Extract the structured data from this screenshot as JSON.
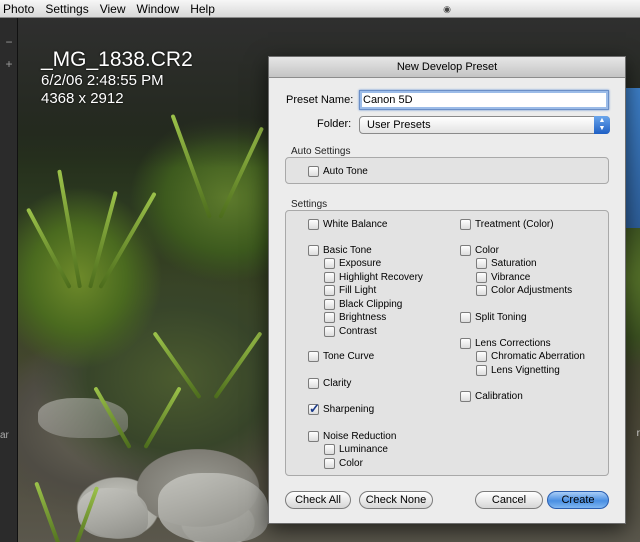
{
  "menubar": {
    "items": [
      "Photo",
      "Settings",
      "View",
      "Window",
      "Help"
    ]
  },
  "photo": {
    "filename": "_MG_1838.CR2",
    "datetime": "6/2/06 2:48:55 PM",
    "dimensions": "4368 x 2912",
    "left_edge_text": "ar"
  },
  "dialog": {
    "title": "New Develop Preset",
    "preset_name_label": "Preset Name:",
    "preset_name_value": "Canon 5D",
    "folder_label": "Folder:",
    "folder_value": "User Presets",
    "auto_settings_label": "Auto Settings",
    "auto_tone_label": "Auto Tone",
    "settings_label": "Settings",
    "left_column": {
      "white_balance": "White Balance",
      "basic_tone": "Basic Tone",
      "exposure": "Exposure",
      "highlight_recovery": "Highlight Recovery",
      "fill_light": "Fill Light",
      "black_clipping": "Black Clipping",
      "brightness": "Brightness",
      "contrast": "Contrast",
      "tone_curve": "Tone Curve",
      "clarity": "Clarity",
      "sharpening": "Sharpening",
      "noise_reduction": "Noise Reduction",
      "luminance": "Luminance",
      "color": "Color"
    },
    "right_column": {
      "treatment": "Treatment (Color)",
      "color": "Color",
      "saturation": "Saturation",
      "vibrance": "Vibrance",
      "color_adjustments": "Color Adjustments",
      "split_toning": "Split Toning",
      "lens_corrections": "Lens Corrections",
      "chromatic_aberration": "Chromatic Aberration",
      "lens_vignetting": "Lens Vignetting",
      "calibration": "Calibration"
    },
    "buttons": {
      "check_all": "Check All",
      "check_none": "Check None",
      "cancel": "Cancel",
      "create": "Create"
    }
  },
  "colors": {
    "default_button": "#4a8fe2",
    "checkmark": "#1b3b8a"
  }
}
